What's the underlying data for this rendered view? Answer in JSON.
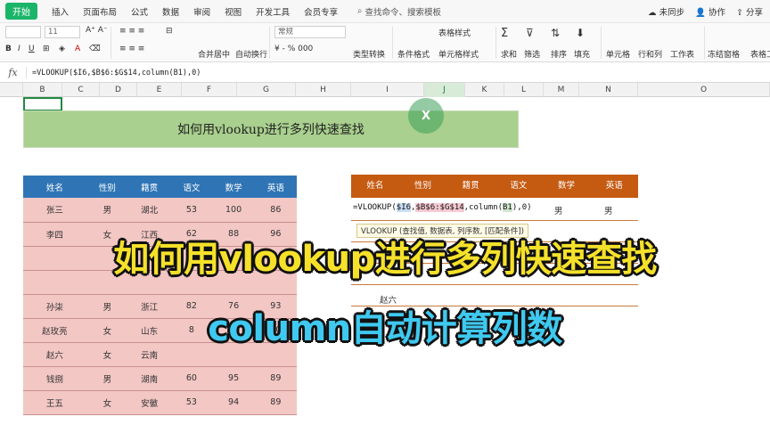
{
  "menubar": {
    "start": "开始",
    "items": [
      "插入",
      "页面布局",
      "公式",
      "数据",
      "审阅",
      "视图",
      "开发工具",
      "会员专享"
    ],
    "search": "查找命令、搜索模板",
    "right": [
      "未同步",
      "协作",
      "分享"
    ]
  },
  "ribbon": {
    "font_name": "",
    "font_size": "11",
    "number_format": "常规",
    "labels": {
      "merge": "合并居中",
      "wrap": "自动换行",
      "type_convert": "类型转换",
      "cond_format": "条件格式",
      "table_style": "表格样式",
      "cell_style": "单元格样式",
      "sum": "求和",
      "filter": "筛选",
      "sort": "排序",
      "fill": "填充",
      "cell": "单元格",
      "rowcol": "行和列",
      "worksheet": "工作表",
      "freeze": "冻结窗格",
      "table_tool": "表格工"
    }
  },
  "formula_bar": {
    "fx": "fx",
    "formula": "=VLOOKUP($I6,$B$6:$G$14,column(B1),0)"
  },
  "columns": [
    "B",
    "C",
    "D",
    "E",
    "F",
    "G",
    "H",
    "I",
    "J",
    "K",
    "L",
    "M",
    "N",
    "O"
  ],
  "banner": {
    "title": "如何用vlookup进行多列快速查找",
    "logo": "X"
  },
  "left_table": {
    "headers": [
      "姓名",
      "性别",
      "籍贯",
      "语文",
      "数学",
      "英语"
    ],
    "rows": [
      [
        "张三",
        "男",
        "湖北",
        "53",
        "100",
        "86"
      ],
      [
        "李四",
        "女",
        "江西",
        "62",
        "88",
        "96"
      ],
      [
        "",
        "",
        "",
        "",
        "",
        ""
      ],
      [
        "",
        "",
        "",
        "",
        "",
        ""
      ],
      [
        "孙柒",
        "男",
        "浙江",
        "82",
        "76",
        "93"
      ],
      [
        "赵玫亮",
        "女",
        "山东",
        "8",
        "",
        "70"
      ],
      [
        "赵六",
        "女",
        "云南",
        "",
        "",
        ""
      ],
      [
        "钱捌",
        "男",
        "湖南",
        "60",
        "95",
        "89"
      ],
      [
        "王五",
        "女",
        "安徽",
        "53",
        "94",
        "89"
      ]
    ]
  },
  "right_table": {
    "headers": [
      "姓名",
      "性别",
      "籍贯",
      "语文",
      "数学",
      "英语"
    ],
    "formula_parts": [
      "=VLOOKUP(",
      "$I6",
      ",",
      "$B$6:$G$14",
      ",column(",
      "B1",
      "),0)"
    ],
    "tooltip": "VLOOKUP (查找值, 数据表, 列序数, [匹配条件])",
    "row1_math": "男",
    "row1_english": "男",
    "name_zhao": "赵六"
  },
  "captions": {
    "line1": "如何用vlookup进行多列快速查找",
    "line2": "column自动计算列数"
  }
}
